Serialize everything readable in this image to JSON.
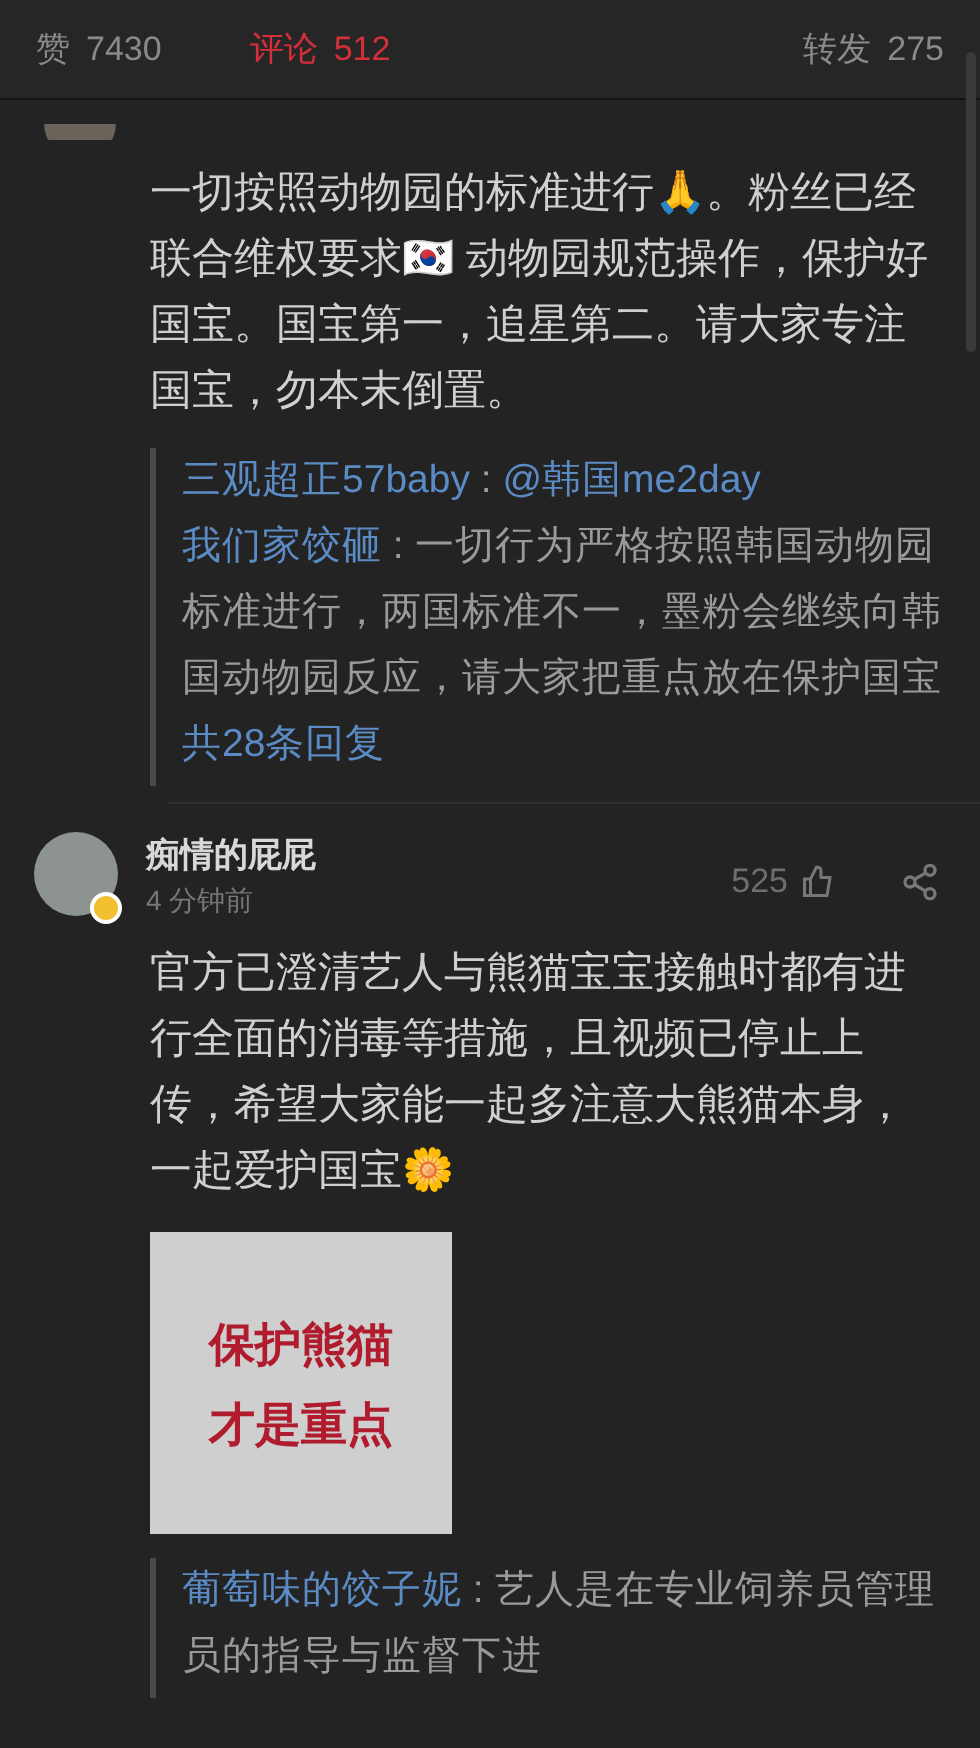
{
  "tabs": [
    {
      "label": "赞",
      "count": "7430",
      "selected": false
    },
    {
      "label": "评论",
      "count": "512",
      "selected": true
    },
    {
      "label": "转发",
      "count": "275",
      "selected": false
    }
  ],
  "comments": [
    {
      "kind": "cut",
      "text": "一切按照动物园的标准进行🙏。粉丝已经联合维权要求🇰🇷 动物园规范操作，保护好国宝。国宝第一，追星第二。请大家专注国宝，勿本末倒置。",
      "replies": [
        {
          "author": "三观超正57baby",
          "separator": ":",
          "text": "@韩国me2day",
          "text_is_link": true
        },
        {
          "author": "我们家饺砸",
          "separator": ":",
          "text": "一切行为严格按照韩国动物园标准进行，两国标准不一，墨粉会继续向韩国动物园反应，请大家把重点放在保护国宝",
          "text_is_link": false
        }
      ],
      "more_replies": "共28条回复"
    },
    {
      "kind": "full",
      "author": "痴情的屁屁",
      "time": "4 分钟前",
      "likes": "525",
      "verified": true,
      "text": "官方已澄清艺人与熊猫宝宝接触时都有进行全面的消毒等措施，且视频已停止上传，希望大家能一起多注意大熊猫本身，一起爱护国宝🌼",
      "sticker": {
        "lines": [
          "保护熊猫",
          "才是重点"
        ]
      },
      "replies": [
        {
          "author": "葡萄味的饺子妮",
          "separator": ":",
          "text": "艺人是在专业饲养员管理员的指导与监督下进",
          "text_is_link": false
        }
      ]
    }
  ]
}
